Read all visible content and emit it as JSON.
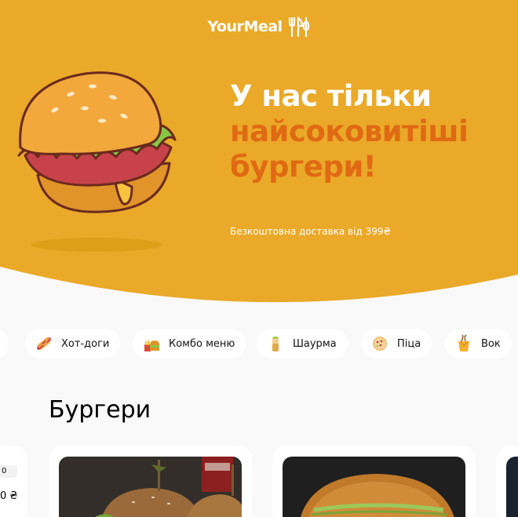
{
  "header": {
    "logo_text": "YourMeal"
  },
  "hero": {
    "title_line1": "У нас тільки",
    "title_line2": "найсоковитіші",
    "title_line3": "бургери!",
    "delivery_text": "Безкоштовна доставка від 399₴"
  },
  "categories": [
    {
      "label": "Хот-доги",
      "icon": "hotdog-icon"
    },
    {
      "label": "Комбо меню",
      "icon": "combo-icon"
    },
    {
      "label": "Шаурма",
      "icon": "shawarma-icon"
    },
    {
      "label": "Піца",
      "icon": "pizza-icon"
    },
    {
      "label": "Вок",
      "icon": "wok-icon"
    }
  ],
  "section": {
    "title": "Бургери"
  },
  "left_card": {
    "tag": "0",
    "price": "0 ₴"
  },
  "colors": {
    "hero_bg": "#eaa928",
    "accent": "#e06a13",
    "page_bg": "#f9f9f9"
  }
}
